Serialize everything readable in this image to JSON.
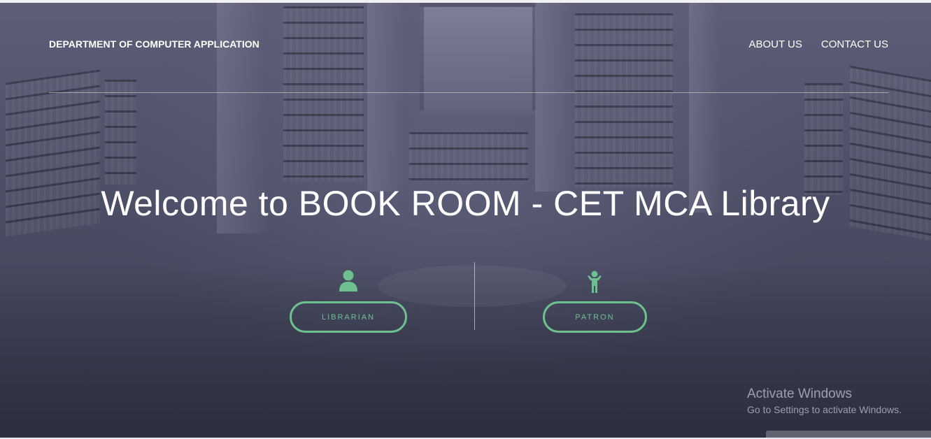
{
  "header": {
    "brand": "DEPARTMENT OF COMPUTER APPLICATION",
    "nav": [
      {
        "label": "ABOUT US"
      },
      {
        "label": "CONTACT US"
      }
    ]
  },
  "hero": {
    "title": "Welcome to BOOK ROOM - CET MCA Library",
    "roles": [
      {
        "label": "LIBRARIAN",
        "icon": "user-icon"
      },
      {
        "label": "PATRON",
        "icon": "child-icon"
      }
    ]
  },
  "watermark": {
    "title": "Activate Windows",
    "subtitle": "Go to Settings to activate Windows."
  },
  "colors": {
    "accent": "#6cc18f",
    "overlay": "#4f5169",
    "text": "#ffffff"
  }
}
